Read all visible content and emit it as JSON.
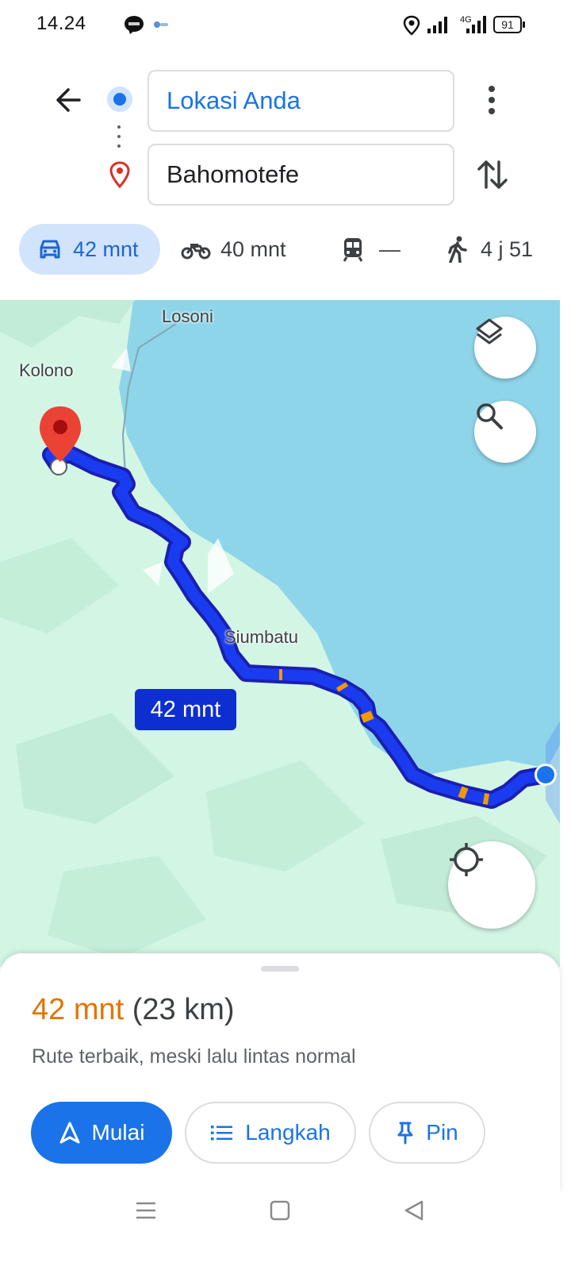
{
  "status_bar": {
    "time": "14.24",
    "battery": "91",
    "network": "4G",
    "icons": [
      "line-app-icon",
      "app-notification-icon",
      "location-icon",
      "signal-icon",
      "signal-4g-icon",
      "battery-icon"
    ]
  },
  "header": {
    "origin": "Lokasi Anda",
    "destination": "Bahomotefe",
    "icons": [
      "back-arrow-icon",
      "origin-dot-icon",
      "destination-pin-icon",
      "more-vert-icon",
      "swap-icon"
    ]
  },
  "modes": [
    {
      "name": "car",
      "label": "42 mnt",
      "selected": true
    },
    {
      "name": "motorcycle",
      "label": "40 mnt",
      "selected": false
    },
    {
      "name": "transit",
      "label": "—",
      "selected": false
    },
    {
      "name": "walk",
      "label": "4 j 51",
      "selected": false
    }
  ],
  "map": {
    "places": [
      "Losoni",
      "Kolono",
      "Siumbatu"
    ],
    "route_label": "42 mnt",
    "colors": {
      "water": "#8fd5ea",
      "land": "#d3f5e4",
      "route": "#1a3cf0",
      "traffic": "#f29900",
      "pin": "#ea4335"
    }
  },
  "sheet": {
    "time": "42 mnt",
    "distance": "(23 km)",
    "subtitle": "Rute terbaik, meski lalu lintas normal",
    "start_label": "Mulai",
    "steps_label": "Langkah",
    "pin_label": "Pin"
  },
  "accent_colors": {
    "primary": "#1a73e8",
    "time": "#e37400",
    "selected_tab": "#d2e3fc"
  }
}
